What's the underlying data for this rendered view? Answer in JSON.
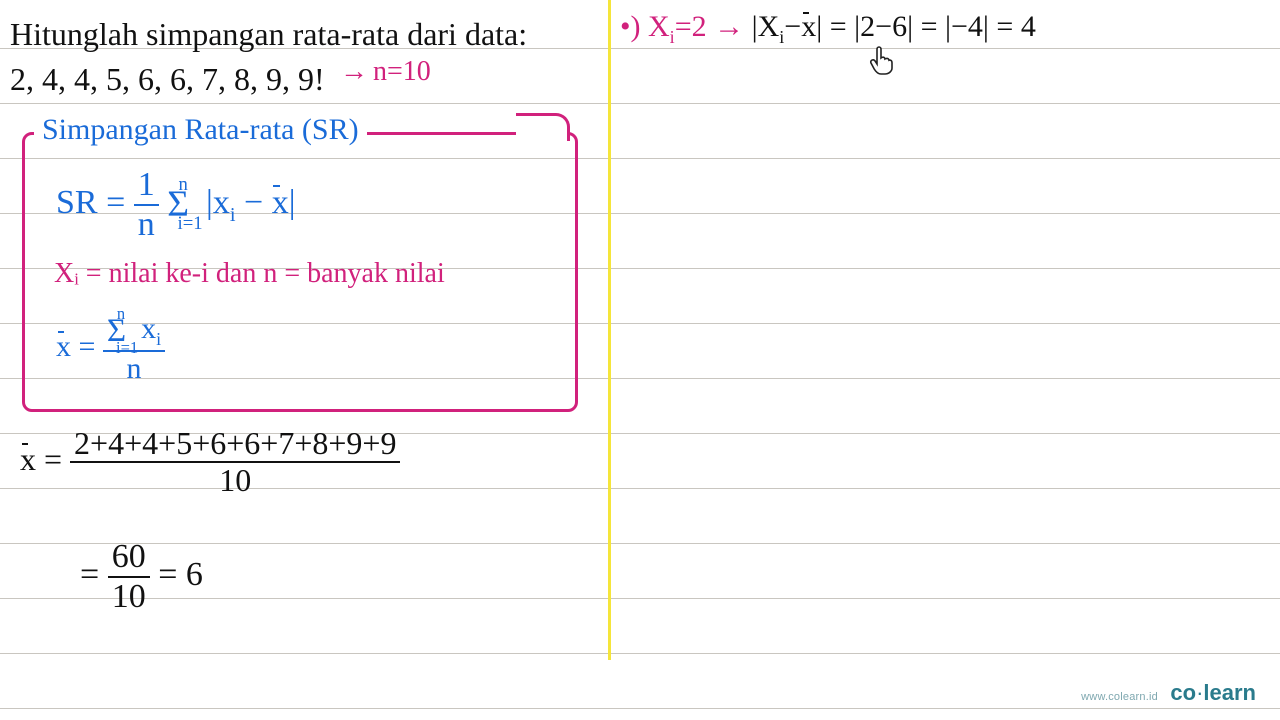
{
  "problem": {
    "line1": "Hitunglah simpangan rata-rata dari data:",
    "line2": "2, 4, 4, 5, 6, 6, 7, 8, 9, 9!",
    "n_annotation": "n=10"
  },
  "box": {
    "title": "Simpangan Rata-rata (SR)",
    "sr_lhs": "SR =",
    "sr_frac_num": "1",
    "sr_frac_den": "n",
    "sr_sum_top": "n",
    "sr_sum_bot": "i=1",
    "sr_body": "|xᵢ − x̄|",
    "defs": "Xᵢ = nilai ke-i  dan  n = banyak nilai",
    "xbar_lhs": "x̄ =",
    "xbar_sum_top": "n",
    "xbar_sum_bot": "i=1",
    "xbar_sum_body": "xᵢ",
    "xbar_den": "n"
  },
  "mean_calc": {
    "lhs": "x̄ =",
    "numerator": "2+4+4+5+6+6+7+8+9+9",
    "denominator": "10",
    "step2_eq": "=",
    "step2_num": "60",
    "step2_den": "10",
    "step2_result": "= 6"
  },
  "right": {
    "bullet": "•)",
    "xi": "Xᵢ=2",
    "arrow": "→",
    "expr": "|Xᵢ−x̄| = |2−6| = |−4| = 4"
  },
  "footer": {
    "url": "www.colearn.id",
    "brand_a": "co",
    "brand_dot": "·",
    "brand_b": "learn"
  }
}
